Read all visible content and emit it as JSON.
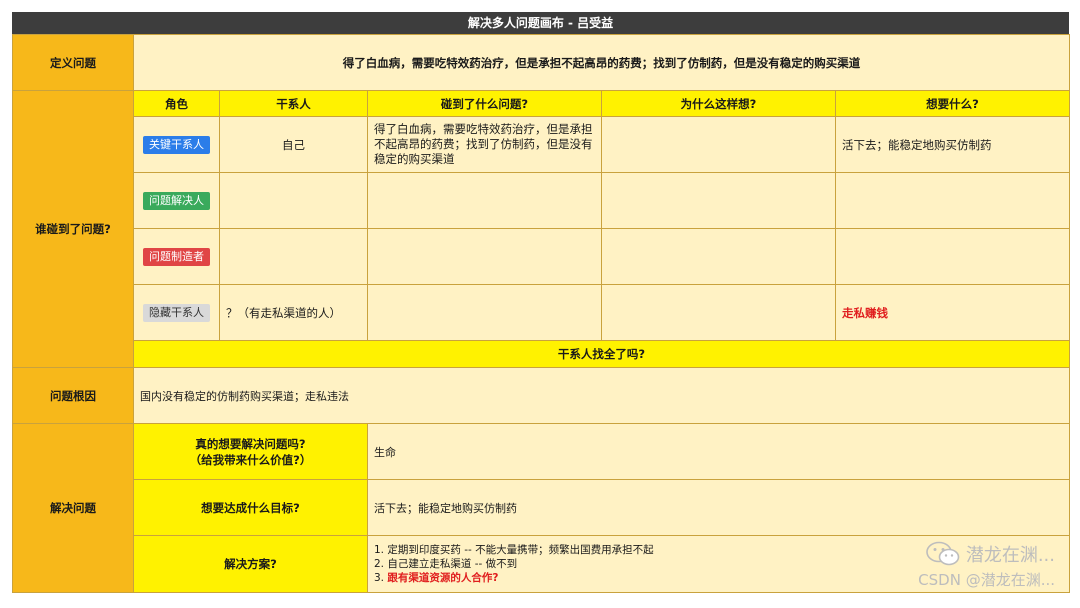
{
  "title": "解决多人问题画布 - 吕受益",
  "define": {
    "label": "定义问题",
    "text": "得了白血病，需要吃特效药治疗，但是承担不起高昂的药费；找到了仿制药，但是没有稳定的购买渠道"
  },
  "who": {
    "label": "谁碰到了问题?",
    "headers": [
      "角色",
      "干系人",
      "碰到了什么问题?",
      "为什么这样想?",
      "想要什么?"
    ],
    "rows": [
      {
        "role": "关键干系人",
        "role_color": "#2b7de9",
        "stakeholder": "自己",
        "problem": "得了白血病，需要吃特效药治疗，但是承担不起高昂的药费；找到了仿制药，但是没有稳定的购买渠道",
        "why": "",
        "want": "活下去；能稳定地购买仿制药"
      },
      {
        "role": "问题解决人",
        "role_color": "#3aaa5c",
        "stakeholder": "",
        "problem": "",
        "why": "",
        "want": ""
      },
      {
        "role": "问题制造者",
        "role_color": "#e04545",
        "stakeholder": "",
        "problem": "",
        "why": "",
        "want": ""
      },
      {
        "role": "隐藏干系人",
        "role_color": "#d9d9d9",
        "stakeholder": "？（有走私渠道的人）",
        "problem": "",
        "why": "",
        "want": "走私赚钱"
      }
    ],
    "footer": "干系人找全了吗?"
  },
  "root_cause": {
    "label": "问题根因",
    "text": "国内没有稳定的仿制药购买渠道；走私违法"
  },
  "solve": {
    "label": "解决问题",
    "q1_line1": "真的想要解决问题吗?",
    "q1_line2": "（给我带来什么价值?）",
    "a1": "生命",
    "q2": "想要达成什么目标?",
    "a2": "活下去；能稳定地购买仿制药",
    "q3": "解决方案?",
    "a3": [
      "1. 定期到印度买药 -- 不能大量携带；频繁出国费用承担不起",
      "2. 自己建立走私渠道 -- 做不到"
    ],
    "a3_prefix": "3.",
    "a3_highlight": "跟有渠道资源的人合作?"
  },
  "watermark": {
    "line1": "潜龙在渊...",
    "line2": "CSDN @潜龙在渊..."
  },
  "colors": {
    "title_bg": "#3d3d3d",
    "label_orange": "#f7b81a",
    "header_yellow": "#fff200",
    "cell_cream": "#fff2c4",
    "highlight_red": "#e01e1e"
  }
}
